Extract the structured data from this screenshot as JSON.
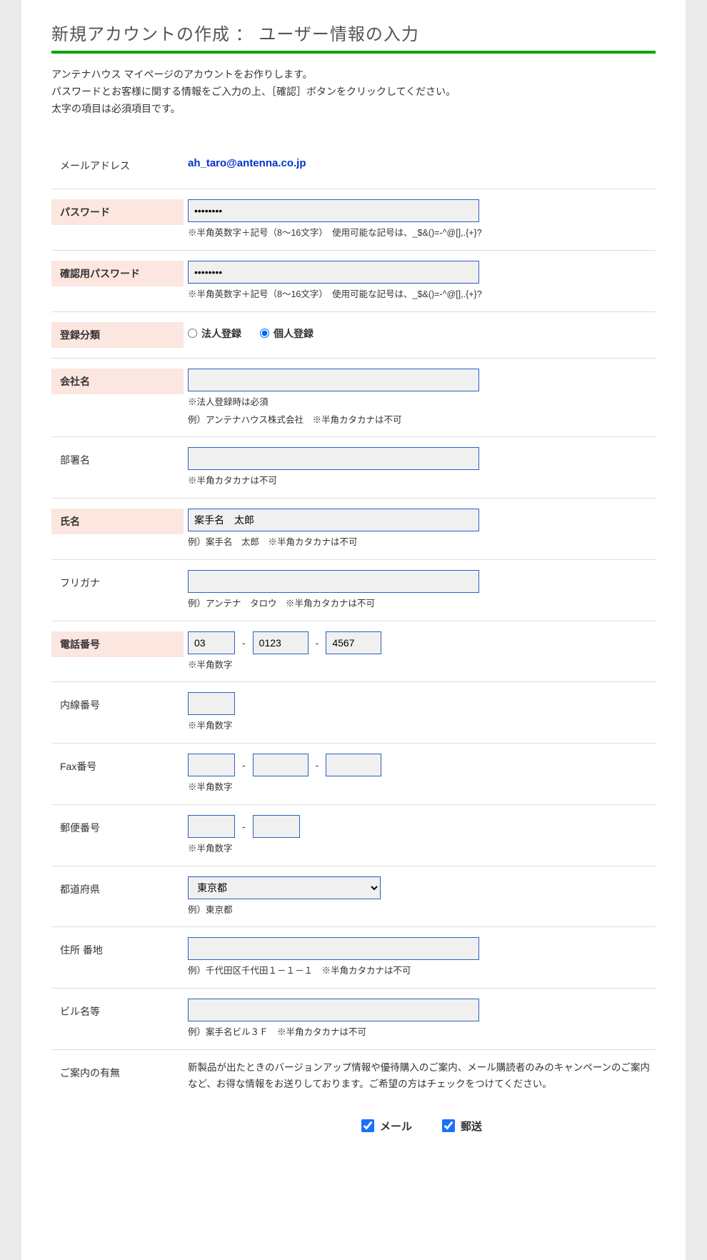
{
  "title": "新規アカウントの作成 ： ユーザー情報の入力",
  "intro": {
    "line1": "アンテナハウス マイページのアカウントをお作りします。",
    "line2": "パスワードとお客様に関する情報をご入力の上、［確認］ボタンをクリックしてください。",
    "line3": "太字の項目は必須項目です。"
  },
  "labels": {
    "email": "メールアドレス",
    "password": "パスワード",
    "password_confirm": "確認用パスワード",
    "reg_type": "登録分類",
    "company": "会社名",
    "department": "部署名",
    "name": "氏名",
    "furigana": "フリガナ",
    "phone": "電話番号",
    "extension": "内線番号",
    "fax": "Fax番号",
    "postal": "郵便番号",
    "prefecture": "都道府県",
    "address": "住所 番地",
    "building": "ビル名等",
    "guidance": "ご案内の有無"
  },
  "values": {
    "email": "ah_taro@antenna.co.jp",
    "password": "••••••••",
    "password_confirm": "••••••••",
    "company": "",
    "department": "",
    "name": "案手名　太郎",
    "furigana": "",
    "phone1": "03",
    "phone2": "0123",
    "phone3": "4567",
    "extension": "",
    "fax1": "",
    "fax2": "",
    "fax3": "",
    "postal1": "",
    "postal2": "",
    "prefecture": "東京都",
    "address": "",
    "building": ""
  },
  "hints": {
    "password": "※半角英数字＋記号（8～16文字）　使用可能な記号は、_$&()=-^@[],.{+}?",
    "company1": "※法人登録時は必須",
    "company2": "例）アンテナハウス株式会社　※半角カタカナは不可",
    "department": "※半角カタカナは不可",
    "name": "例）案手名　太郎　※半角カタカナは不可",
    "furigana": "例）アンテナ　タロウ　※半角カタカナは不可",
    "phone": "※半角数字",
    "extension": "※半角数字",
    "fax": "※半角数字",
    "postal": "※半角数字",
    "prefecture": "例）東京都",
    "address": "例）千代田区千代田１－１－１　※半角カタカナは不可",
    "building": "例）案手名ビル３Ｆ　※半角カタカナは不可"
  },
  "reg_type": {
    "corp": "法人登録",
    "indiv": "個人登録",
    "selected": "indiv"
  },
  "guidance": {
    "text": "新製品が出たときのバージョンアップ情報や優待購入のご案内、メール購読者のみのキャンペーンのご案内など、お得な情報をお送りしております。ご希望の方はチェックをつけてください。",
    "mail": "メール",
    "post": "郵送",
    "mail_checked": true,
    "post_checked": true
  },
  "sep": "-"
}
